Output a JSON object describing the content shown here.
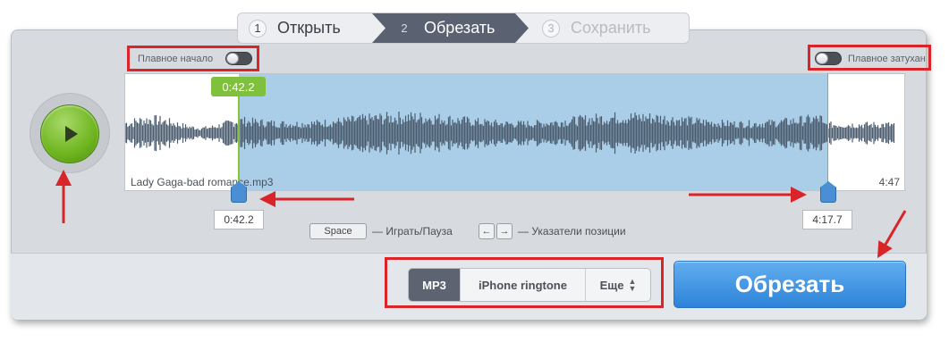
{
  "steps": [
    {
      "num": "1",
      "label": "Открыть"
    },
    {
      "num": "2",
      "label": "Обрезать"
    },
    {
      "num": "3",
      "label": "Сохранить"
    }
  ],
  "toggles": {
    "fade_in_label": "Плавное начало",
    "fade_out_label": "Плавное затухан"
  },
  "waveform": {
    "file_name": "Lady Gaga-bad romance.mp3",
    "duration": "4:47",
    "start_tag": "0:42.2",
    "start_time": "0:42.2",
    "end_time": "4:17.7",
    "selection_start_fraction": 0.147,
    "selection_end_fraction": 0.894
  },
  "hints": {
    "space_key": "Space",
    "space_text": "— Играть/Пауза",
    "left_key": "←",
    "right_key": "→",
    "arrows_text": "— Указатели позиции"
  },
  "formats": {
    "mp3": "MP3",
    "iphone": "iPhone ringtone",
    "more": "Еще"
  },
  "cut_button": "Обрезать",
  "colors": {
    "accent_green": "#7fc03c",
    "accent_blue": "#3b8fde",
    "annotation_red": "#d9242a"
  }
}
